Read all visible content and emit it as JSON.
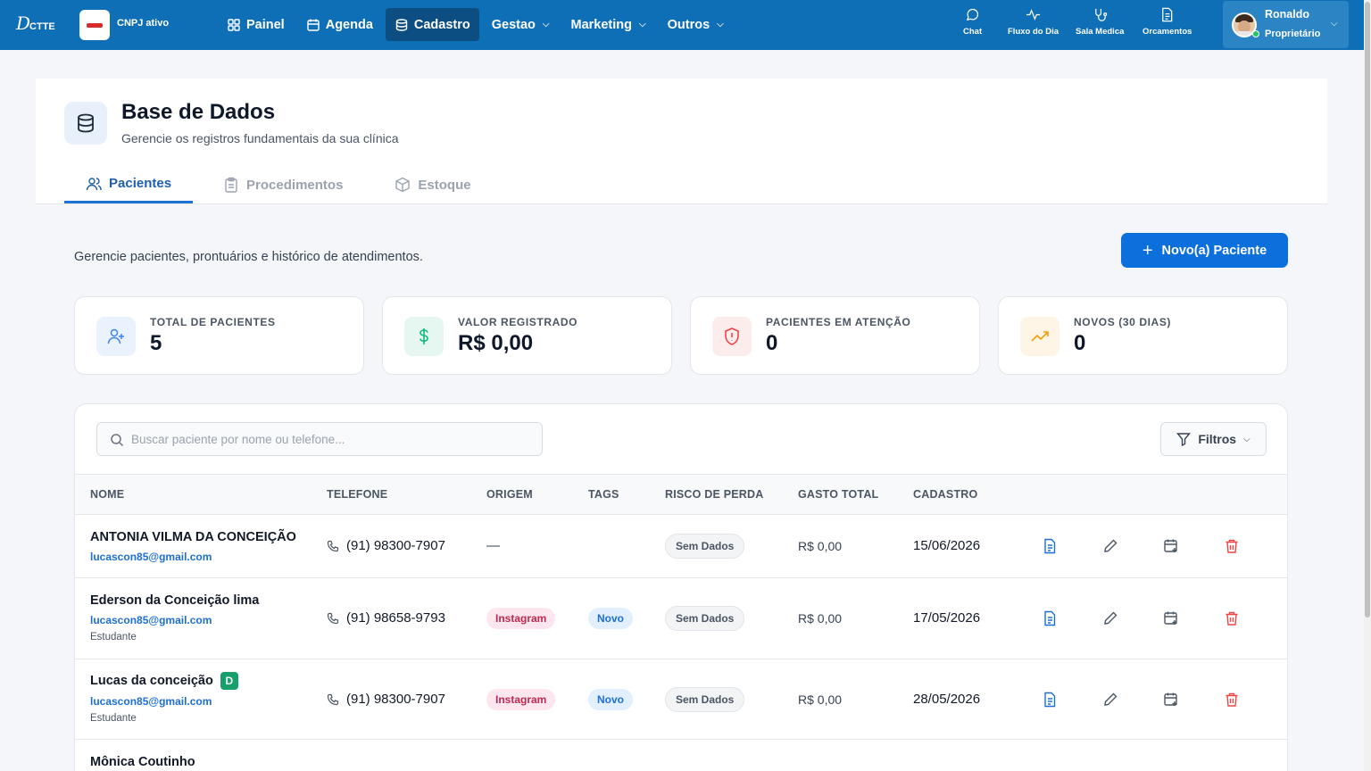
{
  "topbar": {
    "logo_main": "D",
    "logo_small": "CTTE",
    "clinic_status": "CNPJ ativo",
    "nav": [
      {
        "label": "Painel"
      },
      {
        "label": "Agenda"
      },
      {
        "label": "Cadastro",
        "active": true
      },
      {
        "label": "Gestao"
      },
      {
        "label": "Marketing"
      },
      {
        "label": "Outros"
      }
    ],
    "quick": [
      {
        "label": "Chat",
        "icon": "chat-icon"
      },
      {
        "label": "Fluxo do Dia",
        "icon": "activity-icon"
      },
      {
        "label": "Sala Medica",
        "icon": "stethoscope-icon"
      },
      {
        "label": "Orcamentos",
        "icon": "document-icon"
      }
    ],
    "user": {
      "name": "Ronaldo",
      "role": "Proprietário"
    }
  },
  "header": {
    "title": "Base de Dados",
    "subtitle": "Gerencie os registros fundamentais da sua clínica",
    "tabs": [
      {
        "label": "Pacientes",
        "active": true
      },
      {
        "label": "Procedimentos"
      },
      {
        "label": "Estoque"
      }
    ]
  },
  "section": {
    "description": "Gerencie pacientes, prontuários e histórico de atendimentos.",
    "new_button": "Novo(a) Paciente"
  },
  "stats": [
    {
      "label": "TOTAL DE PACIENTES",
      "value": "5",
      "color": "#3b82f6"
    },
    {
      "label": "VALOR REGISTRADO",
      "value": "R$ 0,00",
      "color": "#10b981"
    },
    {
      "label": "PACIENTES EM ATENÇÃO",
      "value": "0",
      "color": "#ef4444"
    },
    {
      "label": "NOVOS (30 DIAS)",
      "value": "0",
      "color": "#f59e0b"
    }
  ],
  "table": {
    "search_placeholder": "Buscar paciente por nome ou telefone...",
    "filters_label": "Filtros",
    "columns": [
      "NOME",
      "TELEFONE",
      "ORIGEM",
      "TAGS",
      "RISCO DE PERDA",
      "GASTO TOTAL",
      "CADASTRO"
    ],
    "rows": [
      {
        "name": "ANTONIA VILMA DA CONCEIÇÃO",
        "email": "lucascon85@gmail.com",
        "occupation": "",
        "badge": "",
        "phone": "(91) 98300-7907",
        "origin": "—",
        "tag": "",
        "risk": "Sem Dados",
        "spent": "R$ 0,00",
        "date": "15/06/2026"
      },
      {
        "name": "Ederson da Conceição lima",
        "email": "lucascon85@gmail.com",
        "occupation": "Estudante",
        "badge": "",
        "phone": "(91) 98658-9793",
        "origin": "Instagram",
        "tag": "Novo",
        "risk": "Sem Dados",
        "spent": "R$ 0,00",
        "date": "17/05/2026"
      },
      {
        "name": "Lucas da conceição",
        "email": "lucascon85@gmail.com",
        "occupation": "Estudante",
        "badge": "D",
        "phone": "(91) 98300-7907",
        "origin": "Instagram",
        "tag": "Novo",
        "risk": "Sem Dados",
        "spent": "R$ 0,00",
        "date": "28/05/2026"
      },
      {
        "name": "Mônica Coutinho",
        "email": "",
        "occupation": "",
        "badge": "",
        "phone": "",
        "origin": "",
        "tag": "",
        "risk": "",
        "spent": "",
        "date": ""
      }
    ]
  }
}
